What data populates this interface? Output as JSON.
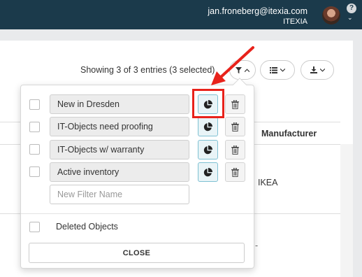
{
  "header": {
    "user_email": "jan.froneberg@itexia.com",
    "company": "ITEXIA",
    "help_label": "?",
    "bg_color": "#1b3a4b"
  },
  "toolbar": {
    "showing_text": "Showing 3 of 3 entries (3 selected)",
    "filter_icon": "filter-icon",
    "list_icon": "list-icon",
    "download_icon": "download-icon"
  },
  "table": {
    "column_header": "Manufacturer",
    "visible_cell": "IKEA",
    "dash_cell": "-"
  },
  "filter_dropdown": {
    "filters": [
      {
        "label": "New in Dresden",
        "checked": false
      },
      {
        "label": "IT-Objects need proofing",
        "checked": false
      },
      {
        "label": "IT-Objects w/ warranty",
        "checked": false
      },
      {
        "label": "Active inventory",
        "checked": false
      }
    ],
    "new_filter_placeholder": "New Filter Name",
    "deleted_objects_label": "Deleted Objects",
    "close_label": "CLOSE"
  },
  "annotation": {
    "color": "#e8221b",
    "highlighted": "pie-chart-button for New in Dresden"
  }
}
